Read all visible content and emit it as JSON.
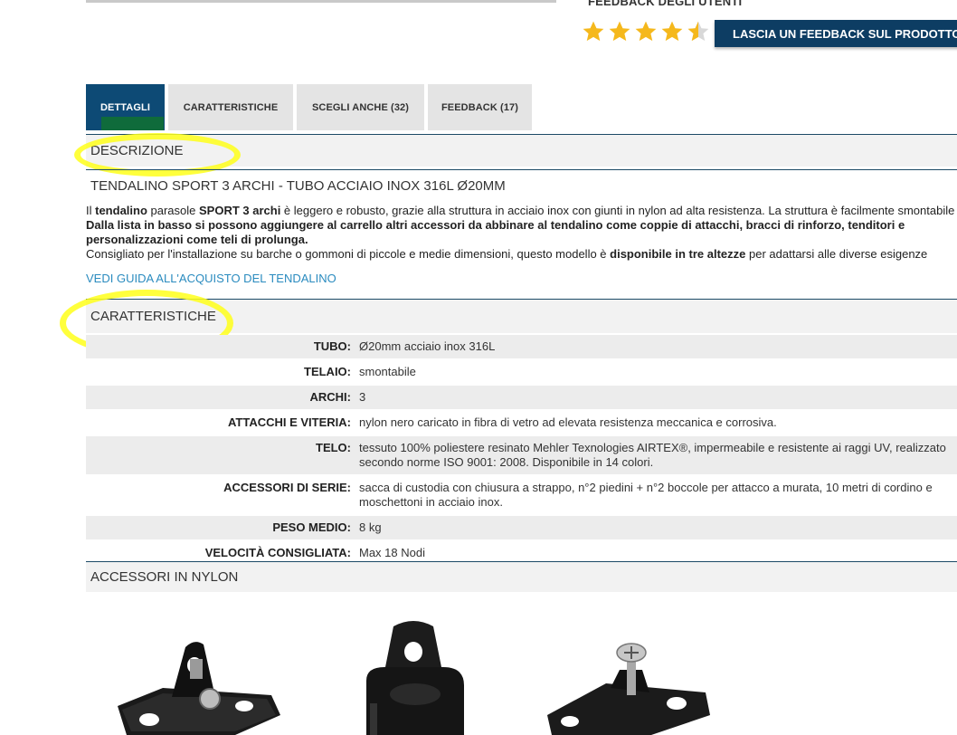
{
  "feedback": {
    "title": "FEEDBACK DEGLI UTENTI",
    "rating": 4.5,
    "max_rating": 5,
    "button_label": "LASCIA UN FEEDBACK SUL PRODOTTO",
    "star_color": "#f5b81c"
  },
  "tabs": [
    {
      "label": "DETTAGLI",
      "active": true
    },
    {
      "label": "CARATTERISTICHE",
      "active": false
    },
    {
      "label": "SCEGLI ANCHE (32)",
      "active": false
    },
    {
      "label": "FEEDBACK (17)",
      "active": false
    }
  ],
  "description": {
    "heading": "DESCRIZIONE",
    "product_title": "TENDALINO SPORT 3 ARCHI - TUBO ACCIAIO INOX 316L Ø20MM",
    "line1": {
      "t1": "Il ",
      "b1": "tendalino",
      "t2": " parasole ",
      "b2": "SPORT 3 archi",
      "t3": " è leggero e robusto, grazie alla struttura in acciaio inox con giunti in nylon ad alta resistenza. La struttura è facilmente smontabile"
    },
    "line2": "Dalla lista in basso si possono aggiungere al carrello altri accessori da abbinare al tendalino come coppie di attacchi, bracci di rinforzo, tenditori e",
    "line3": "personalizzazioni come teli di prolunga.",
    "line4": {
      "t1": "Consigliato per l'installazione su barche o gommoni di piccole e medie dimensioni, questo modello è ",
      "b1": "disponibile in tre altezze",
      "t2": " per adattarsi alle diverse esigenze"
    },
    "guide_link": "VEDI GUIDA ALL'ACQUISTO DEL TENDALINO"
  },
  "features": {
    "heading": "CARATTERISTICHE",
    "rows": [
      {
        "label": "TUBO:",
        "value": "Ø20mm acciaio inox 316L"
      },
      {
        "label": "TELAIO:",
        "value": "smontabile"
      },
      {
        "label": "ARCHI:",
        "value": "3"
      },
      {
        "label": "ATTACCHI E VITERIA:",
        "value": "nylon nero caricato in fibra di vetro ad elevata resistenza meccanica e corrosiva."
      },
      {
        "label": "TELO:",
        "value": "tessuto 100% poliestere resinato Mehler Texnologies AIRTEX®, impermeabile e resistente ai raggi UV, realizzato secondo norme ISO 9001: 2008. Disponibile in 14 colori."
      },
      {
        "label": "ACCESSORI DI SERIE:",
        "value": "sacca di custodia con chiusura a strappo, n°2 piedini + n°2 boccole per attacco a murata, 10 metri di cordino e moschettoni in acciaio inox."
      },
      {
        "label": "PESO MEDIO:",
        "value": "8 kg"
      },
      {
        "label": "VELOCITÀ CONSIGLIATA:",
        "value": "Max 18 Nodi"
      }
    ]
  },
  "accessories": {
    "heading": "ACCESSORI IN NYLON"
  },
  "colors": {
    "accent": "#0d4a75",
    "button": "#0d3d63",
    "link": "#2a8bbf",
    "highlight": "#ffff1a",
    "section_bg": "#f2f2f2"
  }
}
